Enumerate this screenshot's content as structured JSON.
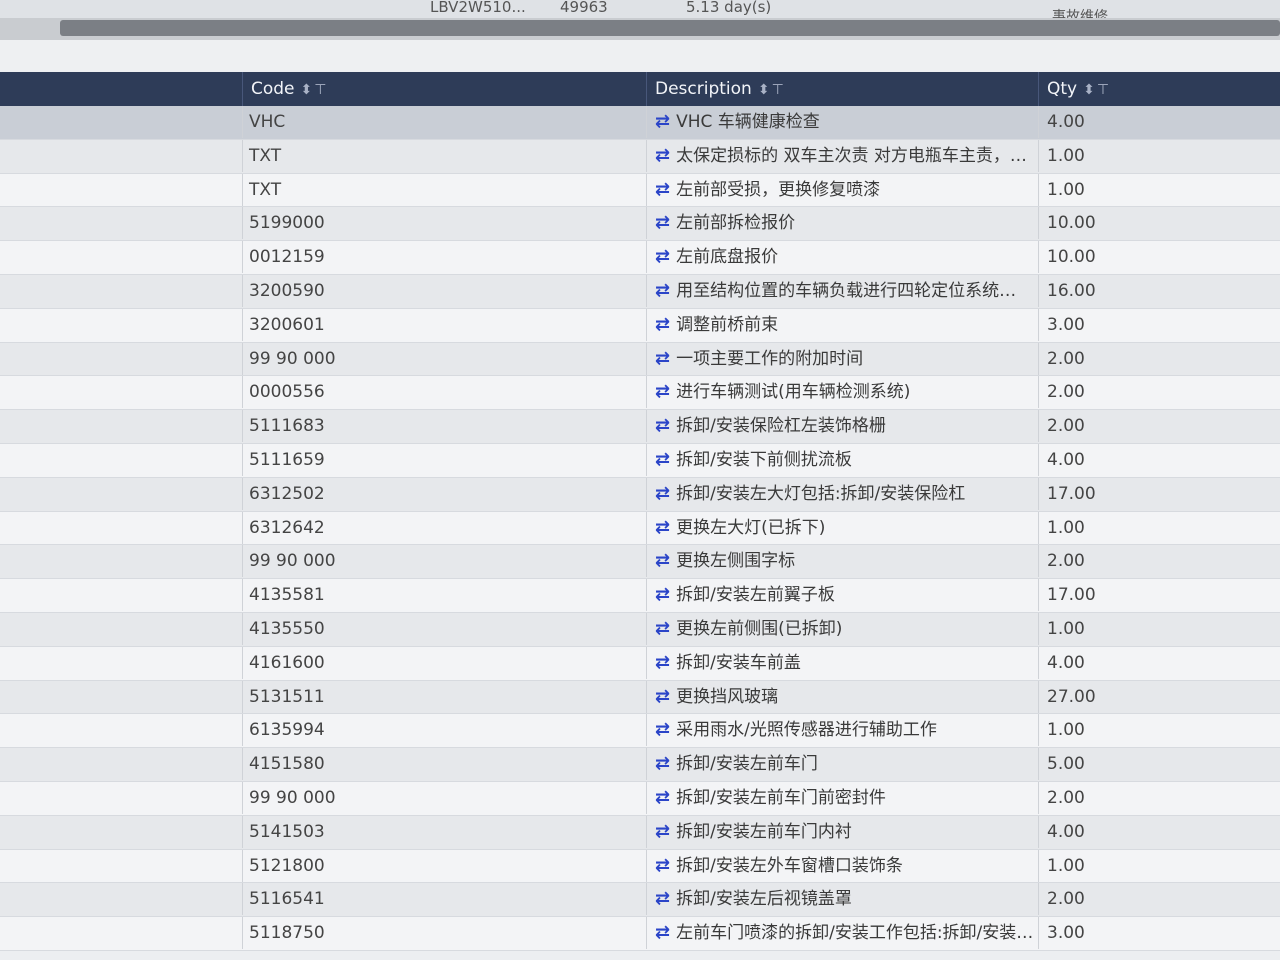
{
  "top_row": {
    "vin": "LBV2W510...",
    "number": "49963",
    "duration": "5.13 day(s)",
    "type": "事故维修"
  },
  "table": {
    "headers": {
      "code": "Code",
      "description": "Description",
      "qty": "Qty"
    },
    "sort_icon": "sort-icon",
    "filter_icon": "filter-icon",
    "rows": [
      {
        "code": "VHC",
        "description": "VHC 车辆健康检查",
        "qty": "4.00"
      },
      {
        "code": "TXT",
        "description": "太保定损标的 双车主次责 对方电瓶车主责，…",
        "qty": "1.00"
      },
      {
        "code": "TXT",
        "description": "左前部受损，更换修复喷漆",
        "qty": "1.00"
      },
      {
        "code": "5199000",
        "description": "左前部拆检报价",
        "qty": "10.00"
      },
      {
        "code": "0012159",
        "description": "左前底盘报价",
        "qty": "10.00"
      },
      {
        "code": "3200590",
        "description": "用至结构位置的车辆负载进行四轮定位系统…",
        "qty": "16.00"
      },
      {
        "code": "3200601",
        "description": "调整前桥前束",
        "qty": "3.00"
      },
      {
        "code": "99 90 000",
        "description": "一项主要工作的附加时间",
        "qty": "2.00"
      },
      {
        "code": "0000556",
        "description": "进行车辆测试(用车辆检测系统)",
        "qty": "2.00"
      },
      {
        "code": "5111683",
        "description": "拆卸/安装保险杠左装饰格栅",
        "qty": "2.00"
      },
      {
        "code": "5111659",
        "description": "拆卸/安装下前侧扰流板",
        "qty": "4.00"
      },
      {
        "code": "6312502",
        "description": "拆卸/安装左大灯包括:拆卸/安装保险杠",
        "qty": "17.00"
      },
      {
        "code": "6312642",
        "description": "更换左大灯(已拆下)",
        "qty": "1.00"
      },
      {
        "code": "99 90 000",
        "description": "更换左侧围字标",
        "qty": "2.00"
      },
      {
        "code": "4135581",
        "description": "拆卸/安装左前翼子板",
        "qty": "17.00"
      },
      {
        "code": "4135550",
        "description": "更换左前侧围(已拆卸)",
        "qty": "1.00"
      },
      {
        "code": "4161600",
        "description": "拆卸/安装车前盖",
        "qty": "4.00"
      },
      {
        "code": "5131511",
        "description": "更换挡风玻璃",
        "qty": "27.00"
      },
      {
        "code": "6135994",
        "description": "采用雨水/光照传感器进行辅助工作",
        "qty": "1.00"
      },
      {
        "code": "4151580",
        "description": "拆卸/安装左前车门",
        "qty": "5.00"
      },
      {
        "code": "99 90 000",
        "description": "拆卸/安装左前车门前密封件",
        "qty": "2.00"
      },
      {
        "code": "5141503",
        "description": "拆卸/安装左前车门内衬",
        "qty": "4.00"
      },
      {
        "code": "5121800",
        "description": "拆卸/安装左外车窗槽口装饰条",
        "qty": "1.00"
      },
      {
        "code": "5116541",
        "description": "拆卸/安装左后视镜盖罩",
        "qty": "2.00"
      },
      {
        "code": "5118750",
        "description": "左前车门喷漆的拆卸/安装工作包括:拆卸/安装…",
        "qty": "3.00"
      }
    ]
  }
}
